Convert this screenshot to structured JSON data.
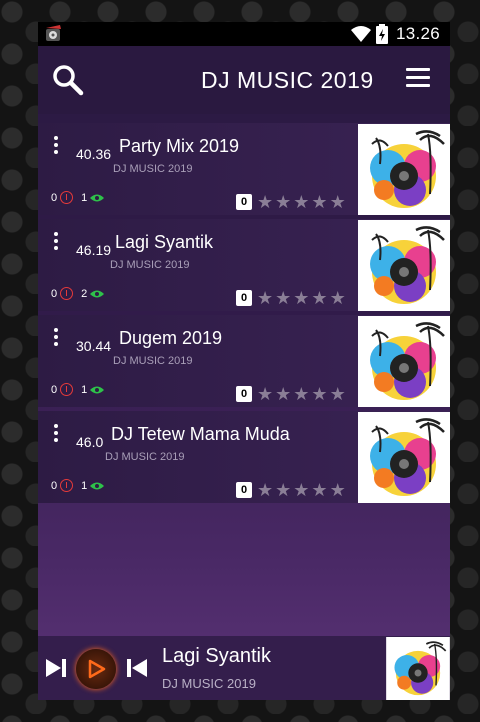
{
  "status_bar": {
    "time": "13.26"
  },
  "toolbar": {
    "title": "DJ MUSIC 2019"
  },
  "songs": [
    {
      "duration": "40.36",
      "title": "Party Mix 2019",
      "artist": "DJ MUSIC 2019",
      "downloads": "0",
      "views": "1",
      "rating_count": "0"
    },
    {
      "duration": "46.19",
      "title": "Lagi Syantik",
      "artist": "DJ MUSIC 2019",
      "downloads": "0",
      "views": "2",
      "rating_count": "0"
    },
    {
      "duration": "30.44",
      "title": "Dugem 2019",
      "artist": "DJ MUSIC 2019",
      "downloads": "0",
      "views": "1",
      "rating_count": "0"
    },
    {
      "duration": "46.0",
      "title": "DJ Tetew Mama Muda",
      "artist": "DJ MUSIC 2019",
      "downloads": "0",
      "views": "1",
      "rating_count": "0"
    }
  ],
  "player": {
    "title": "Lagi Syantik",
    "artist": "DJ MUSIC 2019"
  },
  "icons": {
    "search": "search-icon",
    "menu": "hamburger-menu-icon",
    "more": "more-vert-icon",
    "download": "download-icon",
    "eye": "eye-icon",
    "star": "star-icon",
    "next": "skip-next-icon",
    "prev": "skip-previous-icon",
    "play": "play-icon"
  },
  "colors": {
    "accent": "#ff6a1a",
    "download": "#e53a3a",
    "views": "#2ec24a",
    "star": "#8a7e96"
  }
}
